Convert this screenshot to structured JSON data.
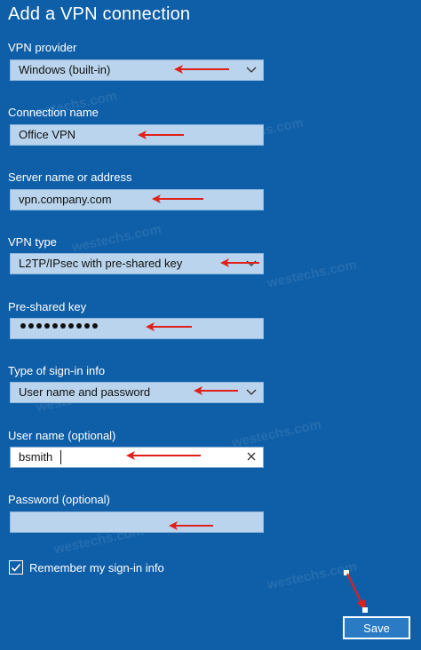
{
  "dialog": {
    "title": "Add a VPN connection"
  },
  "fields": {
    "vpn_provider": {
      "label": "VPN provider",
      "value": "Windows (built-in)"
    },
    "connection_name": {
      "label": "Connection name",
      "value": "Office VPN"
    },
    "server": {
      "label": "Server name or address",
      "value": "vpn.company.com"
    },
    "vpn_type": {
      "label": "VPN type",
      "value": "L2TP/IPsec with pre-shared key"
    },
    "preshared_key": {
      "label": "Pre-shared key",
      "masked_length": 10
    },
    "signin_type": {
      "label": "Type of sign-in info",
      "value": "User name and password"
    },
    "username": {
      "label": "User name (optional)",
      "value": "bsmith"
    },
    "password": {
      "label": "Password (optional)",
      "value": ""
    }
  },
  "remember": {
    "label": "Remember my sign-in info",
    "checked": true
  },
  "save_button": {
    "label": "Save"
  },
  "watermark": {
    "text": "westechs.com"
  },
  "colors": {
    "background": "#0f5fa8",
    "field_fill": "#b9d4ec",
    "annotation_arrow": "#e0201b"
  }
}
